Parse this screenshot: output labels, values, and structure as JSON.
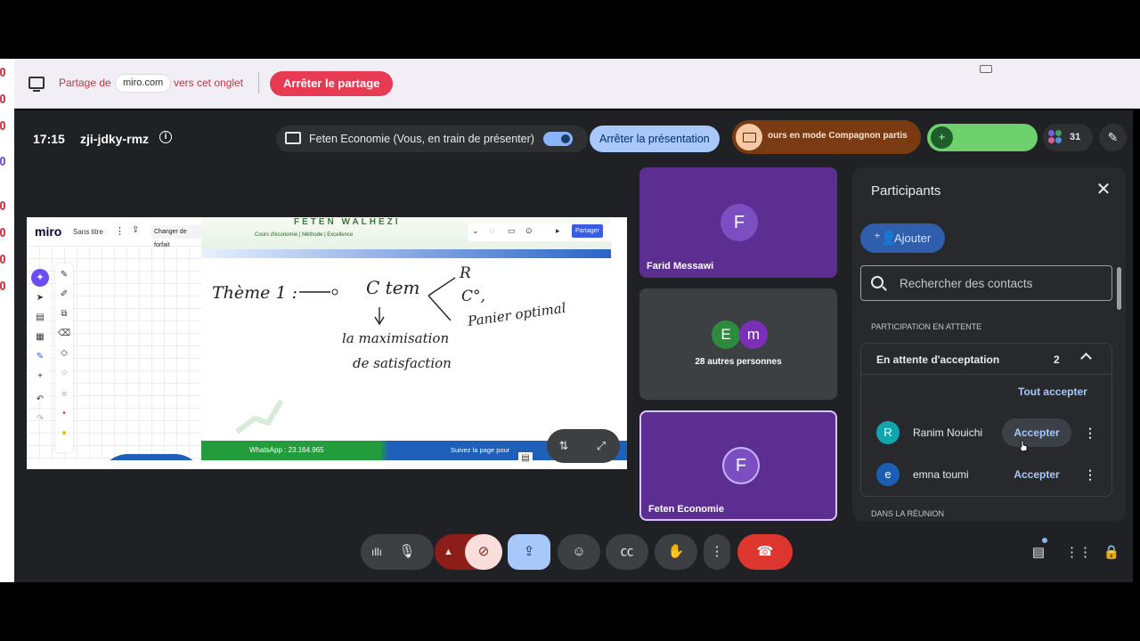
{
  "share_banner": {
    "prefix": "Partage de",
    "site": "miro.com",
    "suffix": "vers cet onglet",
    "stop_label": "Arrêter le partage"
  },
  "meeting": {
    "time": "17:15",
    "code": "zji-jdky-rmz",
    "presenting_label": "Feten Economie (Vous, en train de présenter)",
    "stop_presentation_label": "Arrêter la présentation",
    "companion_label": "ours en mode Compagnon partis",
    "participant_count": "31"
  },
  "miro": {
    "logo": "miro",
    "board_name": "Sans titre",
    "plan_label": "Changer de forfait",
    "share_label": "Partager",
    "slide_brand": "FETEN WALHEZI",
    "slide_links": "Cours d'économie  |  Méthode  |  Excellence",
    "whatsapp": "WhatsApp : 23.164.965",
    "follow": "Suivez la page pour",
    "handwriting": {
      "line1": "Thème 1 :",
      "line2": "C tem",
      "line3": "R",
      "line4": "C°,",
      "line5": "Panier optimal",
      "line6": "la maximisation",
      "line7": "de satisfaction"
    }
  },
  "tiles": {
    "tile1": {
      "initial": "F",
      "name": "Farid Messawi"
    },
    "tile2": {
      "initial1": "E",
      "initial2": "m",
      "label": "28 autres personnes"
    },
    "tile3": {
      "initial": "F",
      "name": "Feten Economie"
    }
  },
  "panel": {
    "title": "Participants",
    "add_label": "Ajouter",
    "search_placeholder": "Rechercher des contacts",
    "section_waiting": "PARTICIPATION EN ATTENTE",
    "waiting_title": "En attente d'acceptation",
    "waiting_count": "2",
    "accept_all": "Tout accepter",
    "people": [
      {
        "initial": "R",
        "name": "Ranim Nouichi",
        "action": "Accepter",
        "color": "#12a4af"
      },
      {
        "initial": "e",
        "name": "emna toumi",
        "action": "Accepter",
        "color": "#1a5fb4"
      }
    ],
    "section_in_meeting": "DANS LA RÉUNION"
  },
  "colors": {
    "meet_bg": "#202124",
    "tile_purple": "#5c2e91",
    "accent_blue": "#a8c7fa",
    "leave_red": "#dc362e",
    "share_red": "#e63b52"
  }
}
